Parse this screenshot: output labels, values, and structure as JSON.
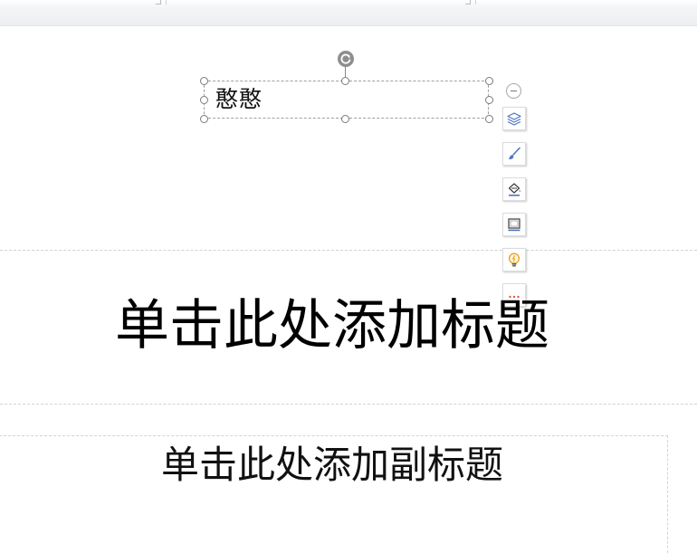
{
  "slide": {
    "selected_textbox": {
      "text": "憨憨"
    },
    "title_placeholder": "单击此处添加标题",
    "subtitle_placeholder": "单击此处添加副标题"
  },
  "floating_toolbar": {
    "items": [
      {
        "icon": "layers-icon"
      },
      {
        "icon": "brush-icon"
      },
      {
        "icon": "fill-bucket-icon"
      },
      {
        "icon": "frame-icon"
      },
      {
        "icon": "lightbulb-icon"
      },
      {
        "icon": "more-icon"
      }
    ]
  },
  "colors": {
    "icon_blue": "#4a78c2",
    "icon_orange": "#e69c1c",
    "icon_red": "#e05a3a",
    "handle_gray": "#7a7a7a"
  }
}
